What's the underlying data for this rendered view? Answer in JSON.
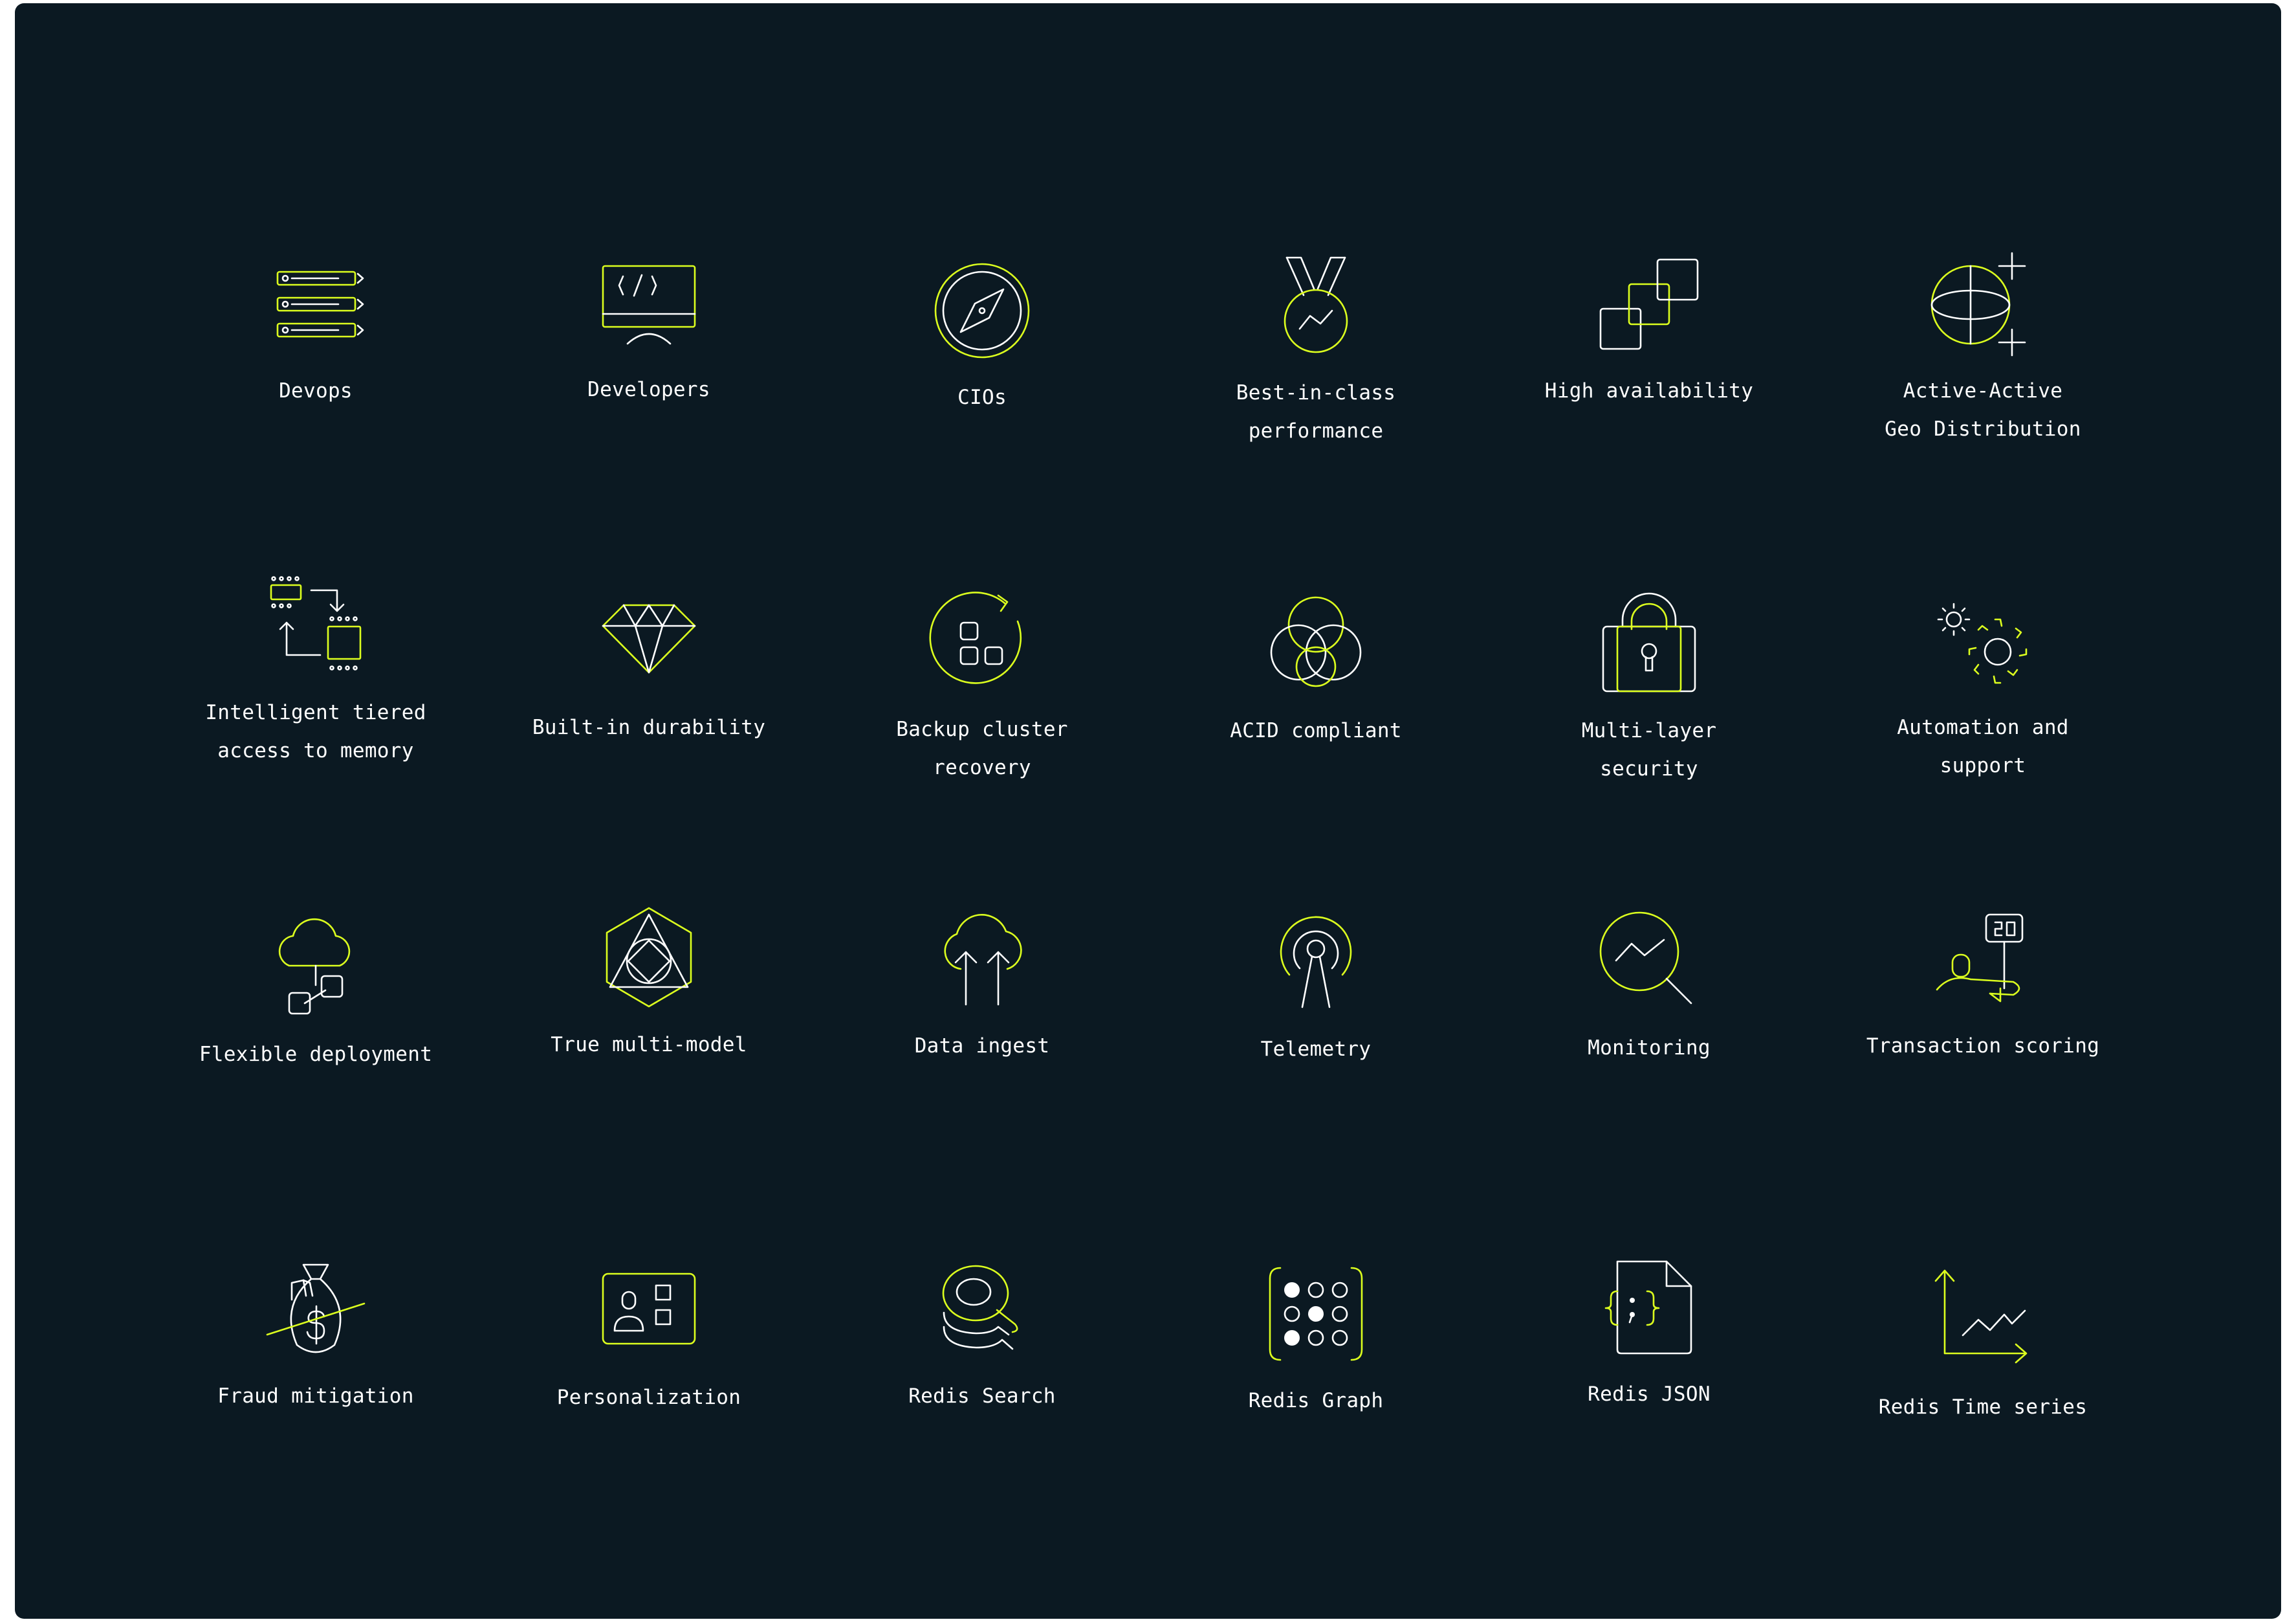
{
  "colors": {
    "background": "#0b1922",
    "accent": "#dcff1e",
    "text": "#ffffff"
  },
  "items": [
    {
      "label": "Devops",
      "icon": "server-stack-icon"
    },
    {
      "label": "Developers",
      "icon": "code-monitor-icon"
    },
    {
      "label": "CIOs",
      "icon": "compass-icon"
    },
    {
      "label": "Best-in-class\nperformance",
      "icon": "medal-icon"
    },
    {
      "label": "High availability",
      "icon": "stacked-squares-icon"
    },
    {
      "label": "Active-Active\nGeo Distribution",
      "icon": "globe-plus-icon"
    },
    {
      "label": "Intelligent tiered\naccess to memory",
      "icon": "tiered-memory-icon"
    },
    {
      "label": "Built-in durability",
      "icon": "diamond-icon"
    },
    {
      "label": "Backup cluster\nrecovery",
      "icon": "backup-recovery-icon"
    },
    {
      "label": "ACID compliant",
      "icon": "venn-circles-icon"
    },
    {
      "label": "Multi-layer\nsecurity",
      "icon": "padlock-icon"
    },
    {
      "label": "Automation and\nsupport",
      "icon": "gears-icon"
    },
    {
      "label": "Flexible deployment",
      "icon": "cloud-deploy-icon"
    },
    {
      "label": "True multi-model",
      "icon": "hexagon-model-icon"
    },
    {
      "label": "Data ingest",
      "icon": "cloud-upload-icon"
    },
    {
      "label": "Telemetry",
      "icon": "antenna-icon"
    },
    {
      "label": "Monitoring",
      "icon": "magnifier-chart-icon"
    },
    {
      "label": "Transaction scoring",
      "icon": "scoring-icon"
    },
    {
      "label": "Fraud mitigation",
      "icon": "money-bag-icon"
    },
    {
      "label": "Personalization",
      "icon": "profile-card-icon"
    },
    {
      "label": "Redis Search",
      "icon": "search-stack-icon"
    },
    {
      "label": "Redis Graph",
      "icon": "dot-graph-icon"
    },
    {
      "label": "Redis JSON",
      "icon": "json-file-icon"
    },
    {
      "label": "Redis Time series",
      "icon": "time-series-icon"
    }
  ]
}
